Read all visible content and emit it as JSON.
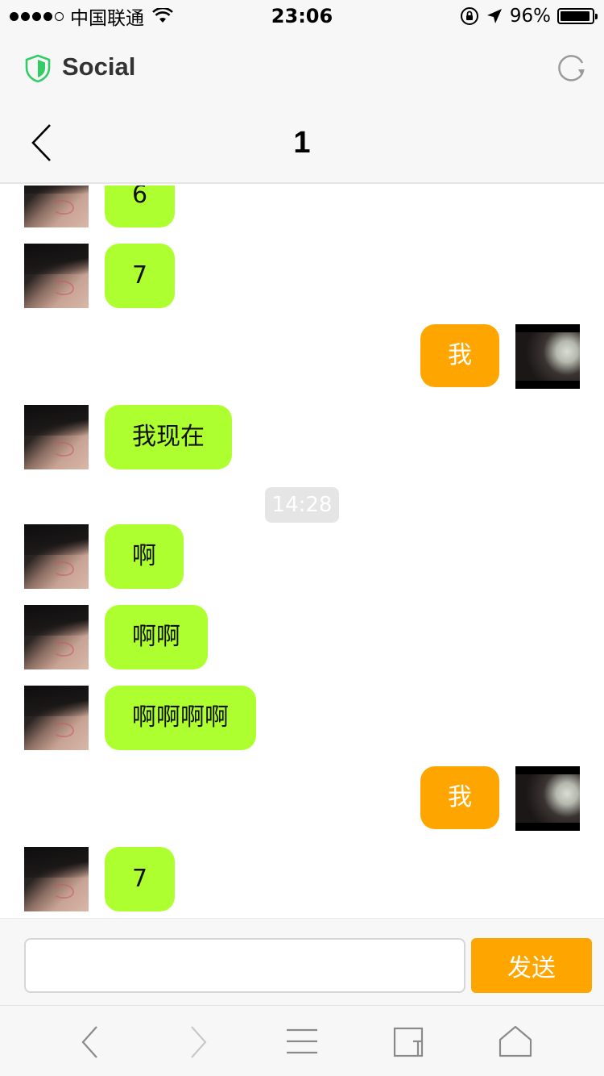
{
  "status_bar": {
    "carrier": "中国联通",
    "time": "23:06",
    "battery_percent": "96%",
    "battery_level": 0.96,
    "signal_bars_filled": 4,
    "signal_bars_total": 5
  },
  "app_header": {
    "title": "Social",
    "icons": {
      "left": "shield-icon",
      "right": "reload-icon"
    },
    "accent_color": "#33cc66"
  },
  "nav": {
    "title": "1",
    "back_icon": "chevron-left-icon"
  },
  "messages": [
    {
      "side": "in",
      "text": "6"
    },
    {
      "side": "in",
      "text": "7"
    },
    {
      "side": "out",
      "text": "我"
    },
    {
      "side": "in",
      "text": "我现在"
    },
    {
      "type": "timestamp",
      "text": "14:28"
    },
    {
      "side": "in",
      "text": "啊"
    },
    {
      "side": "in",
      "text": "啊啊"
    },
    {
      "side": "in",
      "text": "啊啊啊啊"
    },
    {
      "side": "out",
      "text": "我"
    },
    {
      "side": "in",
      "text": "7"
    }
  ],
  "composer": {
    "input_value": "",
    "send_label": "发送"
  },
  "toolbar": {
    "icons": [
      "back-arrow-icon",
      "forward-arrow-icon",
      "menu-icon",
      "tabs-icon",
      "home-icon"
    ]
  },
  "colors": {
    "incoming_bubble": "#adff2f",
    "outgoing_bubble": "#ffa500",
    "send_button": "#ffa500",
    "timestamp_bg": "#e5e5e5"
  }
}
